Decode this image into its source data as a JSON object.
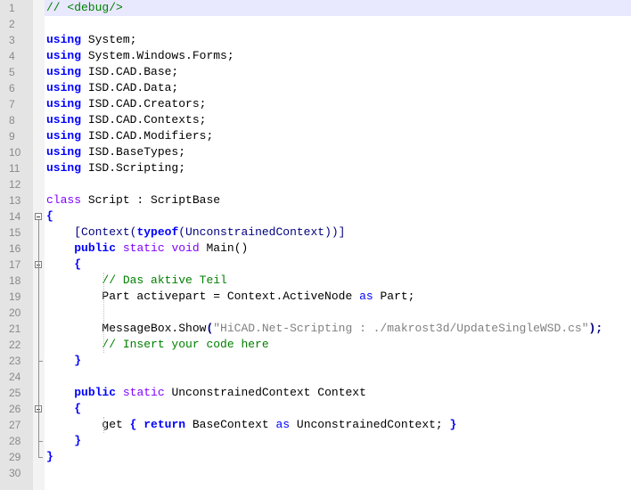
{
  "editor": {
    "current_line": 1,
    "folds": [
      14,
      17,
      26
    ],
    "fold_ends": [
      23,
      28,
      29
    ],
    "lines": [
      {
        "n": "1",
        "tokens": [
          {
            "c": "cm",
            "t": "// <debug/>"
          }
        ]
      },
      {
        "n": "2",
        "tokens": []
      },
      {
        "n": "3",
        "tokens": [
          {
            "c": "kw",
            "t": "using"
          },
          {
            "c": "",
            "t": " System;"
          }
        ]
      },
      {
        "n": "4",
        "tokens": [
          {
            "c": "kw",
            "t": "using"
          },
          {
            "c": "",
            "t": " System.Windows.Forms;"
          }
        ]
      },
      {
        "n": "5",
        "tokens": [
          {
            "c": "kw",
            "t": "using"
          },
          {
            "c": "",
            "t": " ISD.CAD.Base;"
          }
        ]
      },
      {
        "n": "6",
        "tokens": [
          {
            "c": "kw",
            "t": "using"
          },
          {
            "c": "",
            "t": " ISD.CAD.Data;"
          }
        ]
      },
      {
        "n": "7",
        "tokens": [
          {
            "c": "kw",
            "t": "using"
          },
          {
            "c": "",
            "t": " ISD.CAD.Creators;"
          }
        ]
      },
      {
        "n": "8",
        "tokens": [
          {
            "c": "kw",
            "t": "using"
          },
          {
            "c": "",
            "t": " ISD.CAD.Contexts;"
          }
        ]
      },
      {
        "n": "9",
        "tokens": [
          {
            "c": "kw",
            "t": "using"
          },
          {
            "c": "",
            "t": " ISD.CAD.Modifiers;"
          }
        ]
      },
      {
        "n": "10",
        "tokens": [
          {
            "c": "kw",
            "t": "using"
          },
          {
            "c": "",
            "t": " ISD.BaseTypes;"
          }
        ]
      },
      {
        "n": "11",
        "tokens": [
          {
            "c": "kw",
            "t": "using"
          },
          {
            "c": "",
            "t": " ISD.Scripting;"
          }
        ]
      },
      {
        "n": "12",
        "tokens": []
      },
      {
        "n": "13",
        "tokens": [
          {
            "c": "kw2",
            "t": "class"
          },
          {
            "c": "",
            "t": " Script : ScriptBase"
          }
        ]
      },
      {
        "n": "14",
        "tokens": [
          {
            "c": "br",
            "t": "{"
          }
        ]
      },
      {
        "n": "15",
        "tokens": [
          {
            "c": "",
            "t": "    "
          },
          {
            "c": "at",
            "t": "[Context("
          },
          {
            "c": "kw",
            "t": "typeof"
          },
          {
            "c": "at",
            "t": "(UnconstrainedContext))]"
          }
        ]
      },
      {
        "n": "16",
        "tokens": [
          {
            "c": "",
            "t": "    "
          },
          {
            "c": "kw",
            "t": "public"
          },
          {
            "c": "",
            "t": " "
          },
          {
            "c": "kw2",
            "t": "static"
          },
          {
            "c": "",
            "t": " "
          },
          {
            "c": "kw2",
            "t": "void"
          },
          {
            "c": "",
            "t": " Main()"
          }
        ]
      },
      {
        "n": "17",
        "tokens": [
          {
            "c": "",
            "t": "    "
          },
          {
            "c": "br",
            "t": "{"
          }
        ]
      },
      {
        "n": "18",
        "tokens": [
          {
            "c": "",
            "t": "        "
          },
          {
            "c": "cm",
            "t": "// Das aktive Teil"
          }
        ]
      },
      {
        "n": "19",
        "tokens": [
          {
            "c": "",
            "t": "        Part activepart = Context.ActiveNode "
          },
          {
            "c": "as",
            "t": "as"
          },
          {
            "c": "",
            "t": " Part;"
          }
        ]
      },
      {
        "n": "20",
        "tokens": []
      },
      {
        "n": "21",
        "tokens": [
          {
            "c": "",
            "t": "        MessageBox.Show"
          },
          {
            "c": "op",
            "t": "("
          },
          {
            "c": "st",
            "t": "\"HiCAD.Net-Scripting : ./makrost3d/UpdateSingleWSD.cs\""
          },
          {
            "c": "op",
            "t": ");"
          }
        ]
      },
      {
        "n": "22",
        "tokens": [
          {
            "c": "",
            "t": "        "
          },
          {
            "c": "cm",
            "t": "// Insert your code here"
          }
        ]
      },
      {
        "n": "23",
        "tokens": [
          {
            "c": "",
            "t": "    "
          },
          {
            "c": "br",
            "t": "}"
          }
        ]
      },
      {
        "n": "24",
        "tokens": []
      },
      {
        "n": "25",
        "tokens": [
          {
            "c": "",
            "t": "    "
          },
          {
            "c": "kw",
            "t": "public"
          },
          {
            "c": "",
            "t": " "
          },
          {
            "c": "kw2",
            "t": "static"
          },
          {
            "c": "",
            "t": " UnconstrainedContext Context"
          }
        ]
      },
      {
        "n": "26",
        "tokens": [
          {
            "c": "",
            "t": "    "
          },
          {
            "c": "br",
            "t": "{"
          }
        ]
      },
      {
        "n": "27",
        "tokens": [
          {
            "c": "",
            "t": "        get "
          },
          {
            "c": "br",
            "t": "{"
          },
          {
            "c": "",
            "t": " "
          },
          {
            "c": "kw",
            "t": "return"
          },
          {
            "c": "",
            "t": " BaseContext "
          },
          {
            "c": "as",
            "t": "as"
          },
          {
            "c": "",
            "t": " UnconstrainedContext; "
          },
          {
            "c": "br",
            "t": "}"
          }
        ]
      },
      {
        "n": "28",
        "tokens": [
          {
            "c": "",
            "t": "    "
          },
          {
            "c": "br",
            "t": "}"
          }
        ]
      },
      {
        "n": "29",
        "tokens": [
          {
            "c": "br",
            "t": "}"
          }
        ]
      },
      {
        "n": "30",
        "tokens": []
      }
    ]
  }
}
